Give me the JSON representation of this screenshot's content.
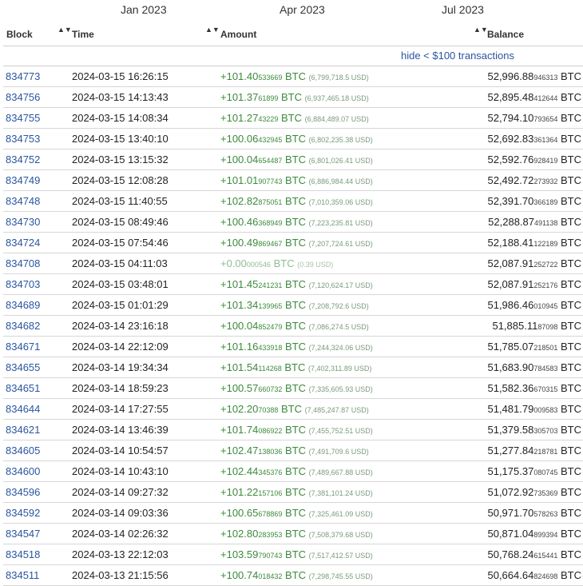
{
  "timeline": {
    "labels": [
      "Jan 2023",
      "Apr 2023",
      "Jul 2023"
    ]
  },
  "table": {
    "headers": {
      "block": "Block",
      "time": "Time",
      "amount": "Amount",
      "balance": "Balance"
    },
    "sort_glyph": "▲▼",
    "filter_link": "hide < $100 transactions",
    "rows": [
      {
        "block": "834773",
        "time": "2024-03-15 16:26:15",
        "amount": "+101.40",
        "amount_fine": "533669",
        "unit": "BTC",
        "usd": "(6,799,718.5 USD)",
        "balance": "52,996.88",
        "balance_fine": "946313",
        "balance_unit": "BTC"
      },
      {
        "block": "834756",
        "time": "2024-03-15 14:13:43",
        "amount": "+101.37",
        "amount_fine": "61899",
        "unit": "BTC",
        "usd": "(6,937,465.18 USD)",
        "balance": "52,895.48",
        "balance_fine": "412644",
        "balance_unit": "BTC"
      },
      {
        "block": "834755",
        "time": "2024-03-15 14:08:34",
        "amount": "+101.27",
        "amount_fine": "43229",
        "unit": "BTC",
        "usd": "(6,884,489.07 USD)",
        "balance": "52,794.10",
        "balance_fine": "793654",
        "balance_unit": "BTC"
      },
      {
        "block": "834753",
        "time": "2024-03-15 13:40:10",
        "amount": "+100.06",
        "amount_fine": "432945",
        "unit": "BTC",
        "usd": "(6,802,235.38 USD)",
        "balance": "52,692.83",
        "balance_fine": "361364",
        "balance_unit": "BTC"
      },
      {
        "block": "834752",
        "time": "2024-03-15 13:15:32",
        "amount": "+100.04",
        "amount_fine": "654487",
        "unit": "BTC",
        "usd": "(6,801,026.41 USD)",
        "balance": "52,592.76",
        "balance_fine": "928419",
        "balance_unit": "BTC"
      },
      {
        "block": "834749",
        "time": "2024-03-15 12:08:28",
        "amount": "+101.01",
        "amount_fine": "907743",
        "unit": "BTC",
        "usd": "(6,886,984.44 USD)",
        "balance": "52,492.72",
        "balance_fine": "273932",
        "balance_unit": "BTC"
      },
      {
        "block": "834748",
        "time": "2024-03-15 11:40:55",
        "amount": "+102.82",
        "amount_fine": "875051",
        "unit": "BTC",
        "usd": "(7,010,359.06 USD)",
        "balance": "52,391.70",
        "balance_fine": "366189",
        "balance_unit": "BTC"
      },
      {
        "block": "834730",
        "time": "2024-03-15 08:49:46",
        "amount": "+100.46",
        "amount_fine": "368949",
        "unit": "BTC",
        "usd": "(7,223,235.81 USD)",
        "balance": "52,288.87",
        "balance_fine": "491138",
        "balance_unit": "BTC"
      },
      {
        "block": "834724",
        "time": "2024-03-15 07:54:46",
        "amount": "+100.49",
        "amount_fine": "869467",
        "unit": "BTC",
        "usd": "(7,207,724.61 USD)",
        "balance": "52,188.41",
        "balance_fine": "122189",
        "balance_unit": "BTC"
      },
      {
        "block": "834708",
        "time": "2024-03-15 04:11:03",
        "amount": "+0.00",
        "amount_fine": "000546",
        "unit": "BTC",
        "usd": "(0.39 USD)",
        "balance": "52,087.91",
        "balance_fine": "252722",
        "balance_unit": "BTC",
        "zero": true
      },
      {
        "block": "834703",
        "time": "2024-03-15 03:48:01",
        "amount": "+101.45",
        "amount_fine": "241231",
        "unit": "BTC",
        "usd": "(7,120,624.17 USD)",
        "balance": "52,087.91",
        "balance_fine": "252176",
        "balance_unit": "BTC"
      },
      {
        "block": "834689",
        "time": "2024-03-15 01:01:29",
        "amount": "+101.34",
        "amount_fine": "139965",
        "unit": "BTC",
        "usd": "(7,208,792.6 USD)",
        "balance": "51,986.46",
        "balance_fine": "010945",
        "balance_unit": "BTC"
      },
      {
        "block": "834682",
        "time": "2024-03-14 23:16:18",
        "amount": "+100.04",
        "amount_fine": "852479",
        "unit": "BTC",
        "usd": "(7,086,274.5 USD)",
        "balance": "51,885.11",
        "balance_fine": "87098",
        "balance_unit": "BTC"
      },
      {
        "block": "834671",
        "time": "2024-03-14 22:12:09",
        "amount": "+101.16",
        "amount_fine": "433918",
        "unit": "BTC",
        "usd": "(7,244,324.06 USD)",
        "balance": "51,785.07",
        "balance_fine": "218501",
        "balance_unit": "BTC"
      },
      {
        "block": "834655",
        "time": "2024-03-14 19:34:34",
        "amount": "+101.54",
        "amount_fine": "114268",
        "unit": "BTC",
        "usd": "(7,402,311.89 USD)",
        "balance": "51,683.90",
        "balance_fine": "784583",
        "balance_unit": "BTC"
      },
      {
        "block": "834651",
        "time": "2024-03-14 18:59:23",
        "amount": "+100.57",
        "amount_fine": "660732",
        "unit": "BTC",
        "usd": "(7,335,605.93 USD)",
        "balance": "51,582.36",
        "balance_fine": "670315",
        "balance_unit": "BTC"
      },
      {
        "block": "834644",
        "time": "2024-03-14 17:27:55",
        "amount": "+102.20",
        "amount_fine": "70388",
        "unit": "BTC",
        "usd": "(7,485,247.87 USD)",
        "balance": "51,481.79",
        "balance_fine": "009583",
        "balance_unit": "BTC"
      },
      {
        "block": "834621",
        "time": "2024-03-14 13:46:39",
        "amount": "+101.74",
        "amount_fine": "086922",
        "unit": "BTC",
        "usd": "(7,455,752.51 USD)",
        "balance": "51,379.58",
        "balance_fine": "305703",
        "balance_unit": "BTC"
      },
      {
        "block": "834605",
        "time": "2024-03-14 10:54:57",
        "amount": "+102.47",
        "amount_fine": "138036",
        "unit": "BTC",
        "usd": "(7,491,709.6 USD)",
        "balance": "51,277.84",
        "balance_fine": "218781",
        "balance_unit": "BTC"
      },
      {
        "block": "834600",
        "time": "2024-03-14 10:43:10",
        "amount": "+102.44",
        "amount_fine": "345376",
        "unit": "BTC",
        "usd": "(7,489,667.88 USD)",
        "balance": "51,175.37",
        "balance_fine": "080745",
        "balance_unit": "BTC"
      },
      {
        "block": "834596",
        "time": "2024-03-14 09:27:32",
        "amount": "+101.22",
        "amount_fine": "157106",
        "unit": "BTC",
        "usd": "(7,381,101.24 USD)",
        "balance": "51,072.92",
        "balance_fine": "735369",
        "balance_unit": "BTC"
      },
      {
        "block": "834592",
        "time": "2024-03-14 09:03:36",
        "amount": "+100.65",
        "amount_fine": "678869",
        "unit": "BTC",
        "usd": "(7,325,461.09 USD)",
        "balance": "50,971.70",
        "balance_fine": "578263",
        "balance_unit": "BTC"
      },
      {
        "block": "834547",
        "time": "2024-03-14 02:26:32",
        "amount": "+102.80",
        "amount_fine": "283953",
        "unit": "BTC",
        "usd": "(7,508,379.68 USD)",
        "balance": "50,871.04",
        "balance_fine": "899394",
        "balance_unit": "BTC"
      },
      {
        "block": "834518",
        "time": "2024-03-13 22:12:03",
        "amount": "+103.59",
        "amount_fine": "790743",
        "unit": "BTC",
        "usd": "(7,517,412.57 USD)",
        "balance": "50,768.24",
        "balance_fine": "615441",
        "balance_unit": "BTC"
      },
      {
        "block": "834511",
        "time": "2024-03-13 21:15:56",
        "amount": "+100.74",
        "amount_fine": "018432",
        "unit": "BTC",
        "usd": "(7,298,745.55 USD)",
        "balance": "50,664.64",
        "balance_fine": "824698",
        "balance_unit": "BTC"
      }
    ]
  }
}
